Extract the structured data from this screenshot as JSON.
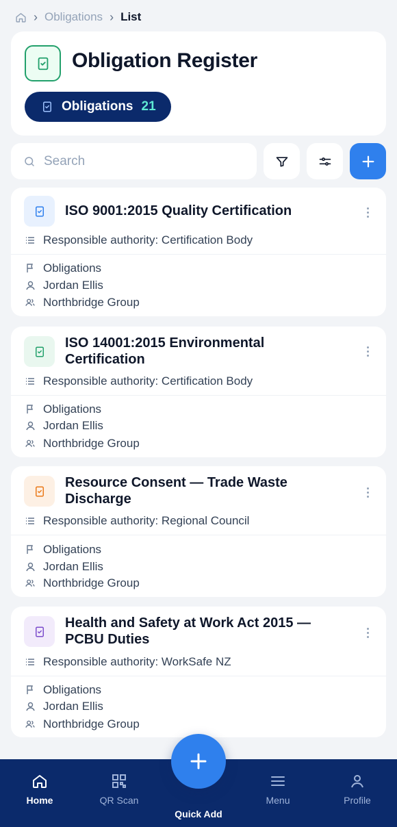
{
  "breadcrumb": {
    "items": [
      {
        "label": "Obligations"
      },
      {
        "label": "List"
      }
    ]
  },
  "header": {
    "title": "Obligation Register",
    "pill_label": "Obligations",
    "pill_count": "21"
  },
  "toolbar": {
    "search_placeholder": "Search"
  },
  "cards": [
    {
      "title": "ISO 9001:2015 Quality Certification",
      "authority": "Responsible authority: Certification Body",
      "category": "Obligations",
      "owner": "Jordan Ellis",
      "group": "Northbridge Group",
      "icon_color": "#2f80ed"
    },
    {
      "title": "ISO 14001:2015 Environmental Certification",
      "authority": "Responsible authority: Certification Body",
      "category": "Obligations",
      "owner": "Jordan Ellis",
      "group": "Northbridge Group",
      "icon_color": "#22a06b"
    },
    {
      "title": "Resource Consent — Trade Waste Discharge",
      "authority": "Responsible authority: Regional Council",
      "category": "Obligations",
      "owner": "Jordan Ellis",
      "group": "Northbridge Group",
      "icon_color": "#ea7a1a"
    },
    {
      "title": "Health and Safety at Work Act 2015 — PCBU Duties",
      "authority": "Responsible authority: WorkSafe NZ",
      "category": "Obligations",
      "owner": "Jordan Ellis",
      "group": "Northbridge Group",
      "icon_color": "#7c4dcc"
    }
  ],
  "nav": {
    "home": "Home",
    "qr": "QR Scan",
    "quick_add": "Quick Add",
    "menu": "Menu",
    "profile": "Profile"
  }
}
